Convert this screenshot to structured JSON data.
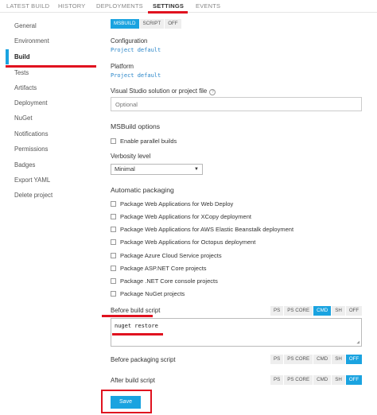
{
  "tabs": [
    "LATEST BUILD",
    "HISTORY",
    "DEPLOYMENTS",
    "SETTINGS",
    "EVENTS"
  ],
  "sidebar": {
    "items": [
      "General",
      "Environment",
      "Build",
      "Tests",
      "Artifacts",
      "Deployment",
      "NuGet",
      "Notifications",
      "Permissions",
      "Badges",
      "Export YAML",
      "Delete project"
    ]
  },
  "build_mode": {
    "options": [
      "MSBUILD",
      "SCRIPT",
      "OFF"
    ],
    "selected": "MSBUILD"
  },
  "configuration": {
    "label": "Configuration",
    "value": "Project default"
  },
  "platform": {
    "label": "Platform",
    "value": "Project default"
  },
  "solution": {
    "label": "Visual Studio solution or project file",
    "placeholder": "Optional"
  },
  "msbuild": {
    "title": "MSBuild options",
    "parallel_label": "Enable parallel builds",
    "verbosity_label": "Verbosity level",
    "verbosity_value": "Minimal"
  },
  "packaging": {
    "title": "Automatic packaging",
    "items": [
      "Package Web Applications for Web Deploy",
      "Package Web Applications for XCopy deployment",
      "Package Web Applications for AWS Elastic Beanstalk deployment",
      "Package Web Applications for Octopus deployment",
      "Package Azure Cloud Service projects",
      "Package ASP.NET Core projects",
      "Package .NET Core console projects",
      "Package NuGet projects"
    ]
  },
  "before_build": {
    "label": "Before build script",
    "options": [
      "PS",
      "PS CORE",
      "CMD",
      "SH",
      "OFF"
    ],
    "selected": "CMD",
    "script": "nuget restore"
  },
  "before_packaging": {
    "label": "Before packaging script",
    "options": [
      "PS",
      "PS CORE",
      "CMD",
      "SH",
      "OFF"
    ],
    "selected": "OFF"
  },
  "after_build": {
    "label": "After build script",
    "options": [
      "PS",
      "PS CORE",
      "CMD",
      "SH",
      "OFF"
    ],
    "selected": "OFF"
  },
  "save_label": "Save",
  "icons": {
    "help": "question-circle-icon",
    "dropdown": "caret-down-icon",
    "resize": "resize-handle-icon"
  },
  "colors": {
    "accent": "#1aa3e0",
    "highlight": "#e0121f"
  }
}
